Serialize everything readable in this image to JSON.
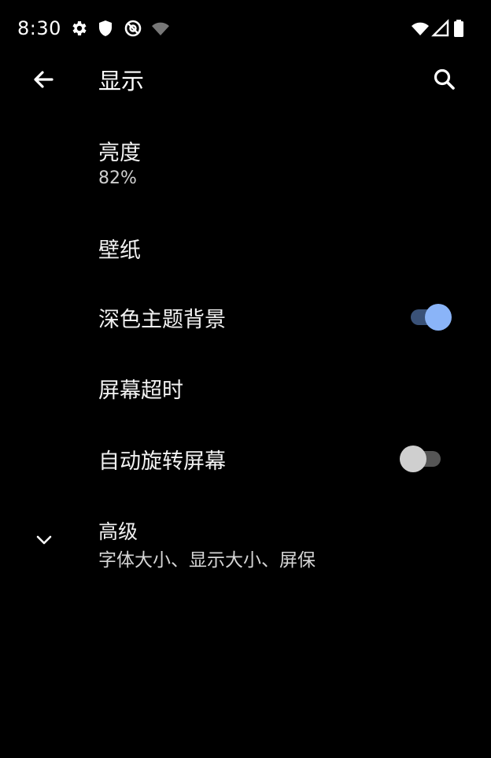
{
  "status_bar": {
    "time": "8:30"
  },
  "header": {
    "title": "显示"
  },
  "settings": {
    "brightness": {
      "label": "亮度",
      "value": "82%"
    },
    "wallpaper": {
      "label": "壁纸"
    },
    "dark_theme": {
      "label": "深色主题背景",
      "enabled": true
    },
    "screen_timeout": {
      "label": "屏幕超时"
    },
    "auto_rotate": {
      "label": "自动旋转屏幕",
      "enabled": false
    },
    "advanced": {
      "label": "高级",
      "summary": "字体大小、显示大小、屏保"
    }
  },
  "colors": {
    "accent": "#8ab4f8",
    "accent_track": "#3a5278",
    "off_thumb": "#cfcfcf",
    "off_track": "#555555"
  },
  "icons": [
    "gear-icon",
    "shield-icon",
    "at-icon",
    "wifi-icon",
    "signal-icon",
    "battery-icon",
    "back-arrow-icon",
    "search-icon",
    "chevron-down-icon"
  ]
}
